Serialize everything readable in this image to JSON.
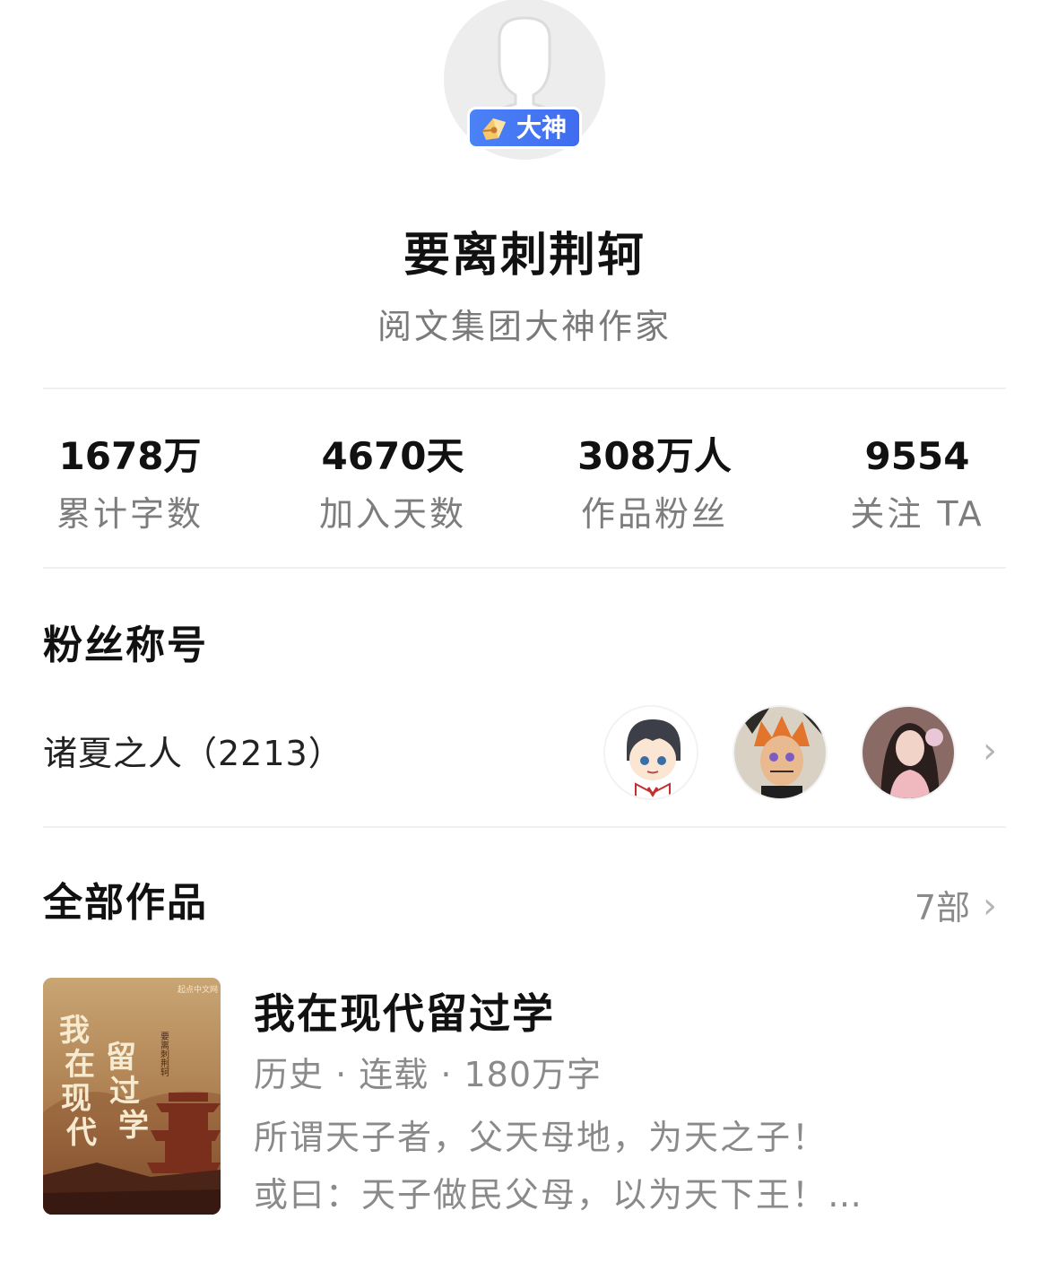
{
  "profile": {
    "badge_label": "大神",
    "name": "要离刺荆轲",
    "subtitle": "阅文集团大神作家"
  },
  "stats": [
    {
      "value": "1678万",
      "label": "累计字数"
    },
    {
      "value": "4670天",
      "label": "加入天数"
    },
    {
      "value": "308万人",
      "label": "作品粉丝"
    },
    {
      "value": "9554",
      "label": "关注 TA"
    }
  ],
  "fans": {
    "section_title": "粉丝称号",
    "fan_title": "诸夏之人（2213）",
    "chevron": "›"
  },
  "works": {
    "section_title": "全部作品",
    "count": "7部",
    "chevron": "›",
    "book": {
      "title": "我在现代留过学",
      "meta": "历史 · 连载 · 180万字",
      "desc_line1": "所谓天子者，父天母地，为天之子！",
      "desc_line2": "或曰：天子做民父母，以为天下王！…",
      "cover_publisher": "起点中文网",
      "cover_title": "我在现代留过学",
      "cover_author": "要离刺荆轲"
    }
  },
  "colors": {
    "badge": "#4b82f6",
    "muted_text": "#8a8a8a",
    "divider": "#f0f0f0"
  }
}
